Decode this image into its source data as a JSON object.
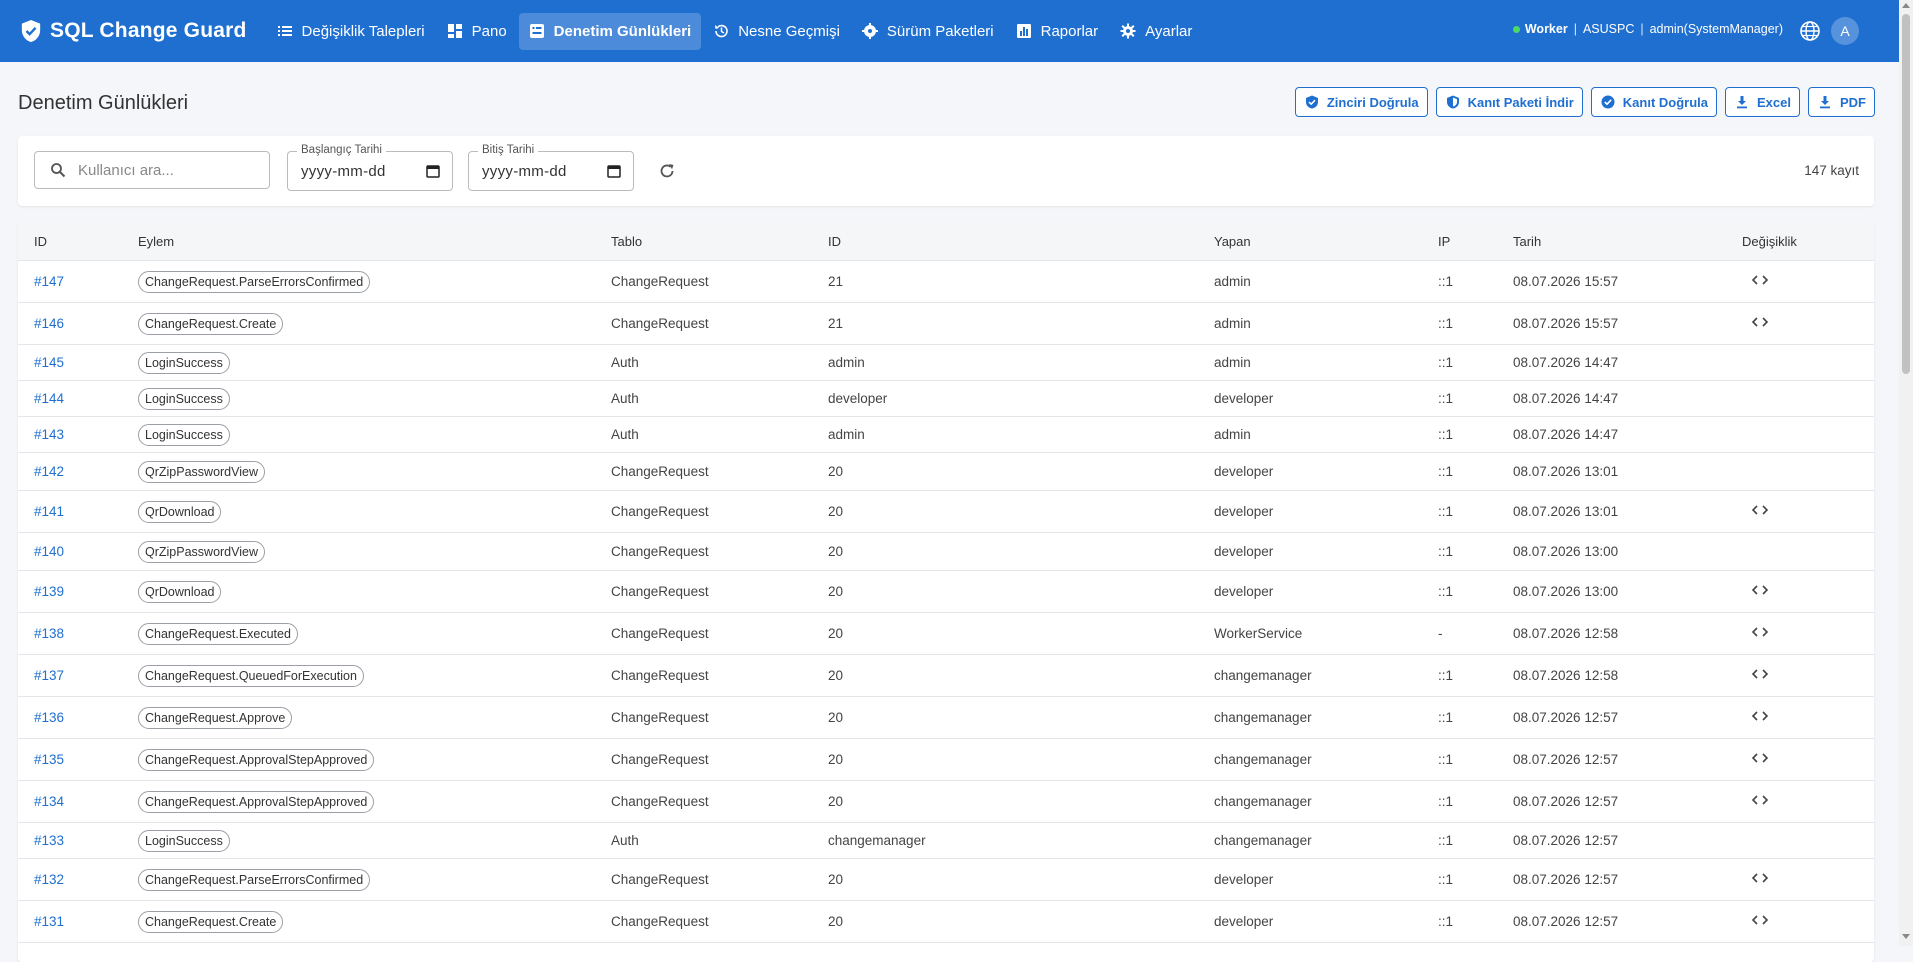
{
  "app": {
    "name": "SQL Change Guard"
  },
  "nav": [
    {
      "label": "Değişiklik Talepleri",
      "icon": "list-icon",
      "active": false
    },
    {
      "label": "Pano",
      "icon": "dashboard-icon",
      "active": false
    },
    {
      "label": "Denetim Günlükleri",
      "icon": "audit-log-icon",
      "active": true
    },
    {
      "label": "Nesne Geçmişi",
      "icon": "history-icon",
      "active": false
    },
    {
      "label": "Sürüm Paketleri",
      "icon": "gear-package-icon",
      "active": false
    },
    {
      "label": "Raporlar",
      "icon": "bar-chart-icon",
      "active": false
    },
    {
      "label": "Ayarlar",
      "icon": "settings-icon",
      "active": false
    }
  ],
  "user": {
    "worker_status": "Worker",
    "machine": "ASUSPC",
    "user": "admin(SystemManager)",
    "avatar_letter": "A",
    "separator": "|"
  },
  "page": {
    "title": "Denetim Günlükleri"
  },
  "actions": {
    "verify_chain": "Zinciri Doğrula",
    "download_evidence": "Kanıt Paketi İndir",
    "verify_evidence": "Kanıt Doğrula",
    "excel": "Excel",
    "pdf": "PDF"
  },
  "filters": {
    "search_placeholder": "Kullanıcı ara...",
    "start_label": "Başlangıç Tarihi",
    "start_value": "yyyy-mm-dd",
    "end_label": "Bitiş Tarihi",
    "end_value": "yyyy-mm-dd",
    "record_count": "147 kayıt"
  },
  "table": {
    "headers": [
      "ID",
      "Eylem",
      "Tablo",
      "ID",
      "Yapan",
      "IP",
      "Tarih",
      "Değişiklik"
    ],
    "rows": [
      {
        "id": "#147",
        "action": "ChangeRequest.ParseErrorsConfirmed",
        "table": "ChangeRequest",
        "entity": "21",
        "by": "admin",
        "ip": "::1",
        "date": "08.07.2026 15:57",
        "change": true
      },
      {
        "id": "#146",
        "action": "ChangeRequest.Create",
        "table": "ChangeRequest",
        "entity": "21",
        "by": "admin",
        "ip": "::1",
        "date": "08.07.2026 15:57",
        "change": true
      },
      {
        "id": "#145",
        "action": "LoginSuccess",
        "table": "Auth",
        "entity": "admin",
        "by": "admin",
        "ip": "::1",
        "date": "08.07.2026 14:47",
        "change": false
      },
      {
        "id": "#144",
        "action": "LoginSuccess",
        "table": "Auth",
        "entity": "developer",
        "by": "developer",
        "ip": "::1",
        "date": "08.07.2026 14:47",
        "change": false
      },
      {
        "id": "#143",
        "action": "LoginSuccess",
        "table": "Auth",
        "entity": "admin",
        "by": "admin",
        "ip": "::1",
        "date": "08.07.2026 14:47",
        "change": false
      },
      {
        "id": "#142",
        "action": "QrZipPasswordView",
        "table": "ChangeRequest",
        "entity": "20",
        "by": "developer",
        "ip": "::1",
        "date": "08.07.2026 13:01",
        "change": false
      },
      {
        "id": "#141",
        "action": "QrDownload",
        "table": "ChangeRequest",
        "entity": "20",
        "by": "developer",
        "ip": "::1",
        "date": "08.07.2026 13:01",
        "change": true
      },
      {
        "id": "#140",
        "action": "QrZipPasswordView",
        "table": "ChangeRequest",
        "entity": "20",
        "by": "developer",
        "ip": "::1",
        "date": "08.07.2026 13:00",
        "change": false
      },
      {
        "id": "#139",
        "action": "QrDownload",
        "table": "ChangeRequest",
        "entity": "20",
        "by": "developer",
        "ip": "::1",
        "date": "08.07.2026 13:00",
        "change": true
      },
      {
        "id": "#138",
        "action": "ChangeRequest.Executed",
        "table": "ChangeRequest",
        "entity": "20",
        "by": "WorkerService",
        "ip": "-",
        "date": "08.07.2026 12:58",
        "change": true
      },
      {
        "id": "#137",
        "action": "ChangeRequest.QueuedForExecution",
        "table": "ChangeRequest",
        "entity": "20",
        "by": "changemanager",
        "ip": "::1",
        "date": "08.07.2026 12:58",
        "change": true
      },
      {
        "id": "#136",
        "action": "ChangeRequest.Approve",
        "table": "ChangeRequest",
        "entity": "20",
        "by": "changemanager",
        "ip": "::1",
        "date": "08.07.2026 12:57",
        "change": true
      },
      {
        "id": "#135",
        "action": "ChangeRequest.ApprovalStepApproved",
        "table": "ChangeRequest",
        "entity": "20",
        "by": "changemanager",
        "ip": "::1",
        "date": "08.07.2026 12:57",
        "change": true
      },
      {
        "id": "#134",
        "action": "ChangeRequest.ApprovalStepApproved",
        "table": "ChangeRequest",
        "entity": "20",
        "by": "changemanager",
        "ip": "::1",
        "date": "08.07.2026 12:57",
        "change": true
      },
      {
        "id": "#133",
        "action": "LoginSuccess",
        "table": "Auth",
        "entity": "changemanager",
        "by": "changemanager",
        "ip": "::1",
        "date": "08.07.2026 12:57",
        "change": false
      },
      {
        "id": "#132",
        "action": "ChangeRequest.ParseErrorsConfirmed",
        "table": "ChangeRequest",
        "entity": "20",
        "by": "developer",
        "ip": "::1",
        "date": "08.07.2026 12:57",
        "change": true
      },
      {
        "id": "#131",
        "action": "ChangeRequest.Create",
        "table": "ChangeRequest",
        "entity": "20",
        "by": "developer",
        "ip": "::1",
        "date": "08.07.2026 12:57",
        "change": true
      }
    ]
  },
  "colors": {
    "primary": "#1f6fd0",
    "online": "#4cd964",
    "background": "#f4f6f9"
  }
}
